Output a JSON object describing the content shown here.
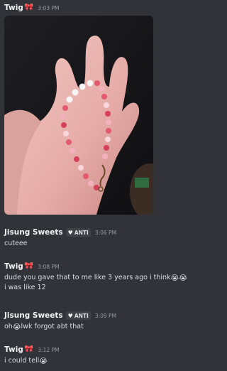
{
  "messages": [
    {
      "author": "Twig",
      "time": "3:03 PM",
      "attachment": "photo of a hand holding a beaded bracelet"
    },
    {
      "author": "Jisung Sweets",
      "badge": "ANTI",
      "time": "3:06 PM",
      "lines": [
        "cuteee"
      ]
    },
    {
      "author": "Twig",
      "time": "3:08 PM",
      "lines": [
        "dude you gave that to me like 3 years ago i think",
        "i was like 12"
      ],
      "emoji": "😭😭"
    },
    {
      "author": "Jisung Sweets",
      "badge": "ANTI",
      "time": "3:09 PM",
      "lines": [
        "oh",
        "lwk forgot abt that"
      ],
      "emoji": "😭"
    },
    {
      "author": "Twig",
      "time": "3:12 PM",
      "lines": [
        "i could tell"
      ],
      "emoji": "😭"
    }
  ],
  "colors": {
    "background": "#313338",
    "username": "#f2f3f5",
    "timestamp": "#949ba4",
    "bow": "#e8384f"
  }
}
